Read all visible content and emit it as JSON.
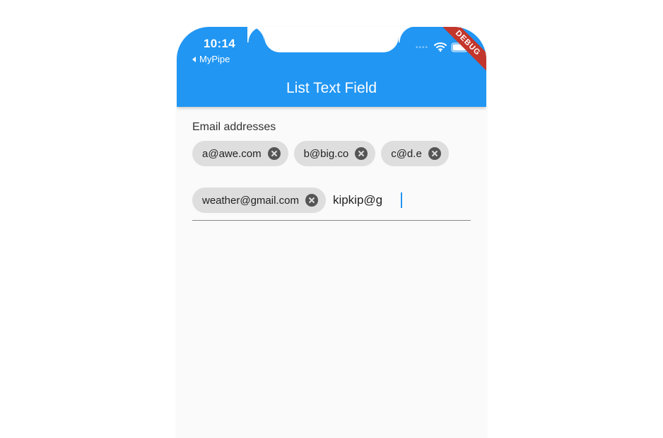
{
  "status_bar": {
    "time": "10:14",
    "back_app_label": "MyPipe"
  },
  "debug_banner": "DEBUG",
  "app_bar": {
    "title": "List Text Field"
  },
  "field": {
    "label": "Email addresses",
    "chips": [
      "a@awe.com",
      "b@big.co",
      "c@d.e",
      "weather@gmail.com"
    ],
    "input_value": "kipkip@g"
  },
  "colors": {
    "primary": "#2196f3",
    "chip_bg": "#dedede",
    "debug_red": "#c3362b"
  }
}
